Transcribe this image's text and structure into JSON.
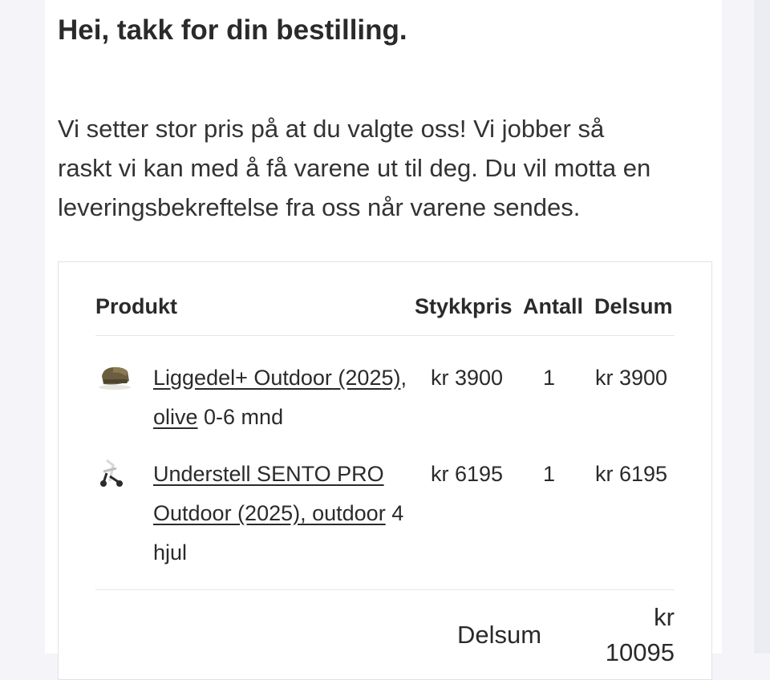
{
  "header": {
    "title": "Hei, takk for din bestilling."
  },
  "intro": {
    "lines": [
      "Vi setter stor pris på at du valgte oss! Vi jobber så",
      "raskt vi kan med å få varene ut til deg. Du vil motta en",
      "leveringsbekreftelse fra oss når varene sendes."
    ]
  },
  "table": {
    "headers": {
      "product": "Produkt",
      "unit_price": "Stykkpris",
      "qty": "Antall",
      "subtotal": "Delsum"
    },
    "items": [
      {
        "name_link_line1": "Liggedel+ Outdoor (2025)",
        "name_line1_suffix": ",",
        "name_link_line2": "olive",
        "name_line2_suffix": " 0-6 mnd",
        "thumb_icon": "bassinet-icon",
        "unit_price": "kr 3900",
        "qty": "1",
        "subtotal": "kr 3900"
      },
      {
        "name_link_line1": "Understell SENTO PRO",
        "name_link_line2": "Outdoor (2025), outdoor",
        "name_line2_suffix": " 4",
        "name_line3": "hjul",
        "thumb_icon": "stroller-frame-icon",
        "unit_price": "kr 6195",
        "qty": "1",
        "subtotal": "kr 6195"
      }
    ],
    "summary": {
      "label": "Delsum",
      "value_line1": "kr",
      "value_line2": "10095"
    }
  },
  "colors": {
    "page_bg": "#f5f4f9",
    "card_bg": "#ffffff",
    "text": "#222222",
    "border": "#e2e2e2"
  }
}
